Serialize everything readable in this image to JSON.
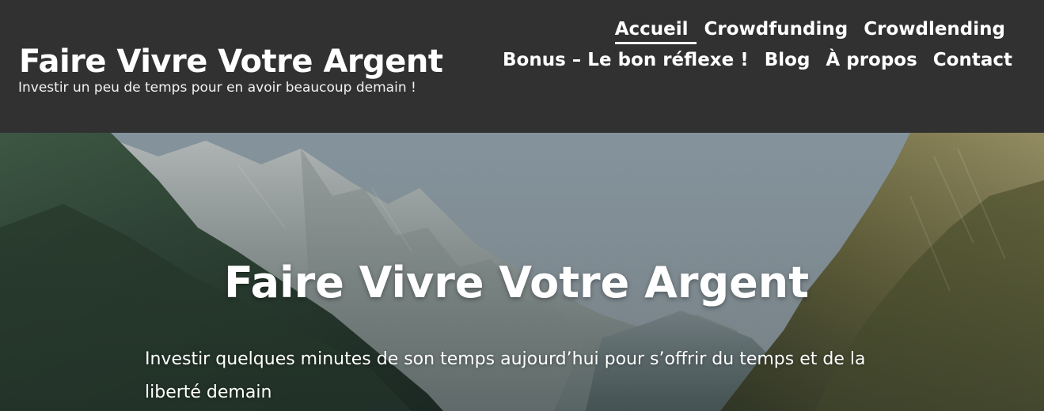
{
  "site": {
    "title": "Faire Vivre Votre Argent",
    "tagline": "Investir un peu de temps pour en avoir beaucoup demain !"
  },
  "nav": {
    "row1": [
      {
        "label": "Accueil",
        "active": true
      },
      {
        "label": "Crowdfunding",
        "active": false
      },
      {
        "label": "Crowdlending",
        "active": false
      }
    ],
    "row2": [
      {
        "label": "Bonus – Le bon réflexe !",
        "active": false
      },
      {
        "label": "Blog",
        "active": false
      },
      {
        "label": "À propos",
        "active": false
      },
      {
        "label": "Contact",
        "active": false
      }
    ]
  },
  "hero": {
    "title": "Faire Vivre Votre Argent",
    "text": "Investir quelques minutes de son temps aujourd’hui pour s’offrir du temps et de la liberté demain",
    "image": "mountain-valley-photo"
  },
  "colors": {
    "header_bg": "#313131",
    "text": "#ffffff"
  }
}
